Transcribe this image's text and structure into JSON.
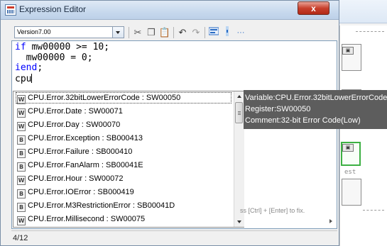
{
  "window": {
    "title": "Expression Editor",
    "close_label": "x"
  },
  "toolbar": {
    "version": "Version7.00",
    "buttons": [
      "cut-icon",
      "copy-icon",
      "paste-icon",
      "undo-icon",
      "redo-icon",
      "comment-icon",
      "indent-icon",
      "more-icon"
    ],
    "more_label": "···"
  },
  "editor": {
    "lines": [
      {
        "kw": "if",
        "text": " mw00000 >= 10;"
      },
      {
        "kw": "",
        "text": "  mw00000 = 0;"
      },
      {
        "kw": "iend",
        "text": ";"
      },
      {
        "kw": "",
        "text": "cpu"
      }
    ]
  },
  "completion": {
    "items": [
      {
        "type": "W",
        "label": "CPU.Error.32bitLowerErrorCode : SW00050",
        "selected": true
      },
      {
        "type": "W",
        "label": "CPU.Error.Date : SW00071"
      },
      {
        "type": "W",
        "label": "CPU.Error.Day : SW00070"
      },
      {
        "type": "B",
        "label": "CPU.Error.Exception : SB000413"
      },
      {
        "type": "B",
        "label": "CPU.Error.Failure : SB000410"
      },
      {
        "type": "B",
        "label": "CPU.Error.FanAlarm : SB00041E"
      },
      {
        "type": "W",
        "label": "CPU.Error.Hour : SW00072"
      },
      {
        "type": "B",
        "label": "CPU.Error.IOError : SB000419"
      },
      {
        "type": "B",
        "label": "CPU.Error.M3RestrictionError : SB00041D"
      },
      {
        "type": "W",
        "label": "CPU.Error.Millisecond : SW00075"
      }
    ]
  },
  "tooltip": {
    "variable": "Variable:CPU.Error.32bitLowerErrorCode",
    "register": "Register:SW00050",
    "comment": "Comment:32-bit Error Code(Low)"
  },
  "status": {
    "position": "4/12"
  },
  "background": {
    "hint": "ss [Ctrl] + [Enter] to fix.",
    "label_rest": "est",
    "chip": "B"
  }
}
